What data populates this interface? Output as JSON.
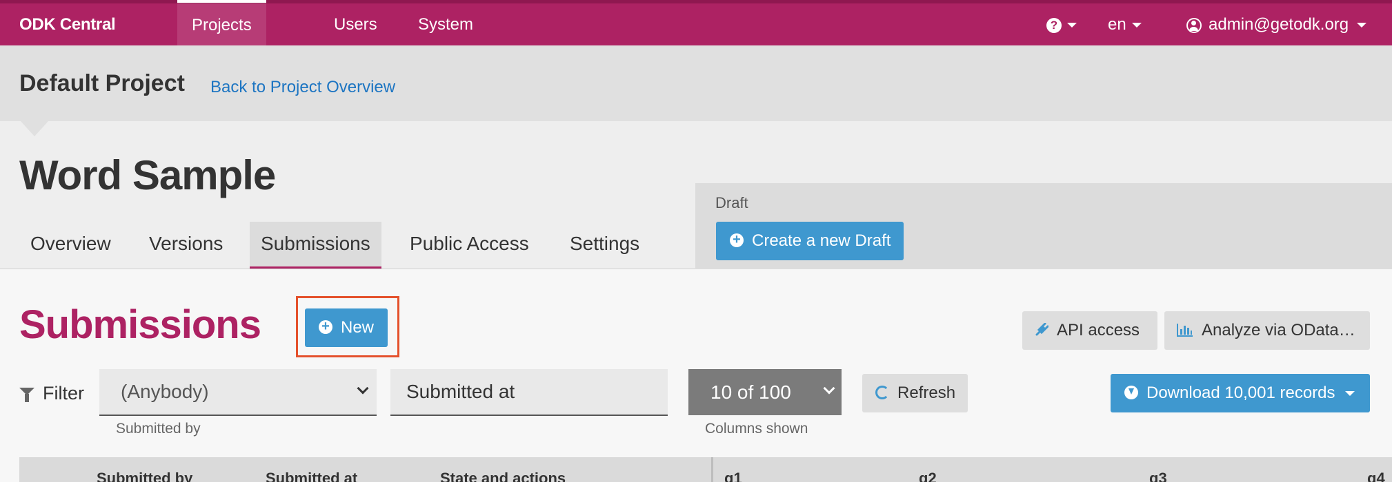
{
  "navbar": {
    "brand": "ODK Central",
    "items": [
      {
        "label": "Projects"
      },
      {
        "label": "Users"
      },
      {
        "label": "System"
      }
    ],
    "help_glyph": "?",
    "language": "en",
    "user": "admin@getodk.org"
  },
  "project": {
    "name": "Default Project",
    "back_link": "Back to Project Overview"
  },
  "form": {
    "title": "Word Sample",
    "tabs": [
      {
        "label": "Overview"
      },
      {
        "label": "Versions"
      },
      {
        "label": "Submissions",
        "active": true
      },
      {
        "label": "Public Access"
      },
      {
        "label": "Settings"
      }
    ],
    "draft": {
      "label": "Draft",
      "create_button": "Create a new Draft"
    }
  },
  "submissions": {
    "title": "Submissions",
    "new_button": "New",
    "api_button": "API access",
    "odata_button": "Analyze via OData…",
    "filter_label": "Filter",
    "submitted_by_value": "(Anybody)",
    "submitted_by_helper": "Submitted by",
    "submitted_at_placeholder": "Submitted at",
    "columns_value": "10 of 100",
    "columns_helper": "Columns shown",
    "refresh_button": "Refresh",
    "download_button": "Download 10,001 records"
  },
  "table": {
    "headers": [
      "Submitted by",
      "Submitted at",
      "State and actions",
      "q1",
      "q2",
      "q3",
      "q4"
    ]
  },
  "colors": {
    "brand": "#ad2263",
    "accent": "#3f98cf",
    "highlight": "#e4512c"
  },
  "icons": [
    "help-icon",
    "caret-down-icon",
    "user-icon",
    "plus-circle-icon",
    "plug-icon",
    "bar-chart-icon",
    "filter-icon",
    "chevron-down-icon",
    "refresh-icon",
    "download-icon"
  ]
}
